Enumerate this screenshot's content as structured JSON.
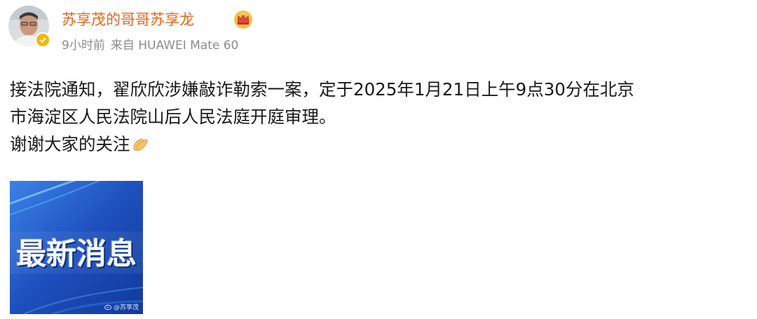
{
  "post": {
    "author": "苏享茂的哥哥苏享龙",
    "time": "9小时前",
    "source": "来自 HUAWEI Mate 60",
    "content_lines": [
      "接法院通知，翟欣欣涉嫌敲诈勒索一案，定于2025年1月21日上午9点30分在北京",
      "市海淀区人民法院山后人民法庭开庭审理。",
      "谢谢大家的关注"
    ],
    "image": {
      "text": "最新消息",
      "watermark": "@苏享茂"
    }
  },
  "icons": {
    "author_badge": "crown-icon",
    "avatar_badge": "verified-icon",
    "emoji": "clapping-hands-icon",
    "watermark": "weibo-logo-icon"
  },
  "colors": {
    "author_name": "#e7651a",
    "meta_text": "#8c8c8c",
    "body_text": "#1a1a1a",
    "image_bg": "#1f54c0"
  }
}
